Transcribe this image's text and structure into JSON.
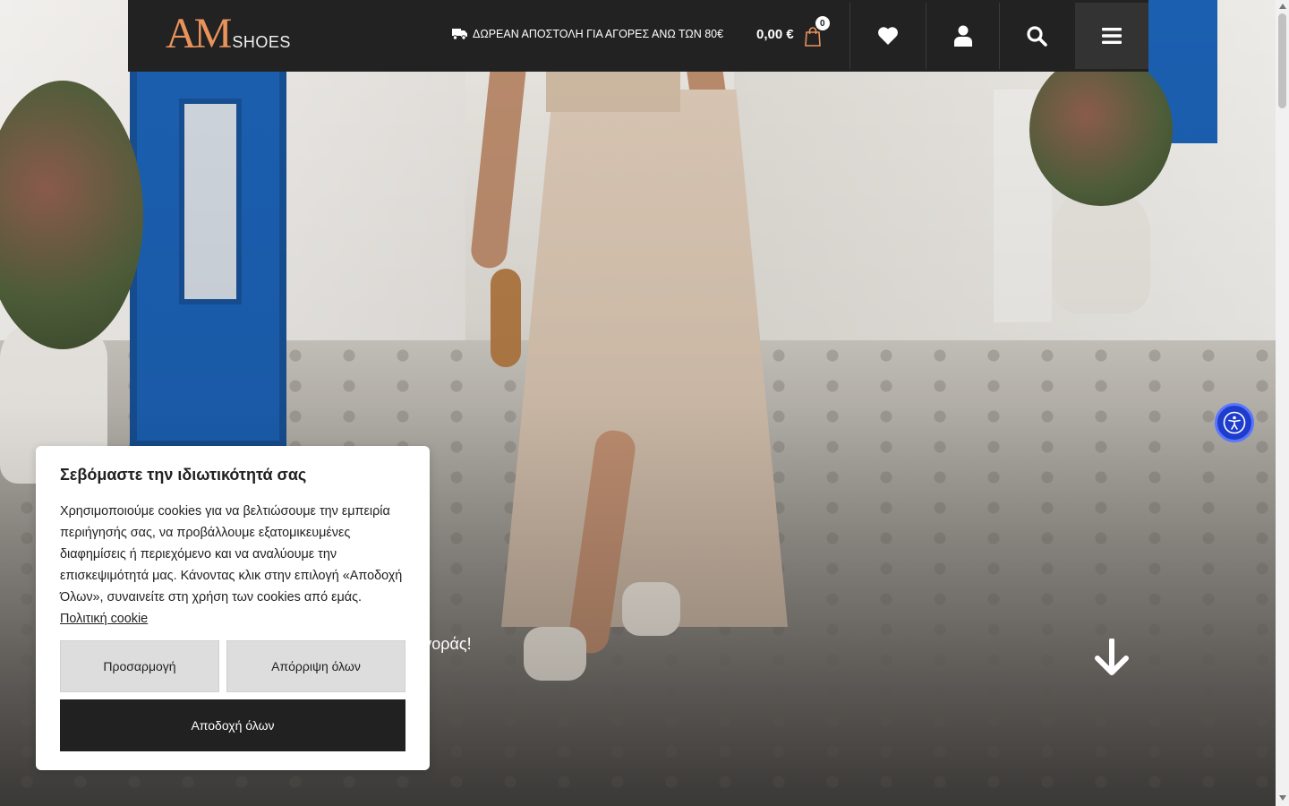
{
  "header": {
    "logo_am": "AM",
    "logo_shoes": "SHOES",
    "shipping_notice": "ΔΩΡΕΑΝ ΑΠΟΣΤΟΛΗ ΓΙΑ ΑΓΟΡΕΣ ΑΝΩ ΤΩΝ 80€",
    "cart_total": "0,00 €",
    "cart_count": "0",
    "icons": [
      "truck-icon",
      "shopping-bag-icon",
      "heart-icon",
      "user-icon",
      "search-icon",
      "menu-icon"
    ]
  },
  "hero": {
    "caption": "μές της αγοράς!"
  },
  "cookie": {
    "title": "Σεβόμαστε την ιδιωτικότητά σας",
    "text": "Χρησιμοποιούμε cookies για να βελτιώσουμε την εμπειρία περιήγησής σας, να προβάλλουμε εξατομικευμένες διαφημίσεις ή περιεχόμενο και να αναλύουμε την επισκεψιμότητά μας. Κάνοντας κλικ στην επιλογή «Αποδοχή Όλων», συναινείτε στη χρήση των cookies από εμάς.",
    "policy_link": "Πολιτική cookie",
    "customize_label": "Προσαρμογή",
    "reject_label": "Απόρριψη όλων",
    "accept_label": "Αποδοχή όλων"
  },
  "colors": {
    "header_bg": "#222222",
    "logo_accent": "#e8935c",
    "a11y_blue": "#1e3dcc"
  }
}
